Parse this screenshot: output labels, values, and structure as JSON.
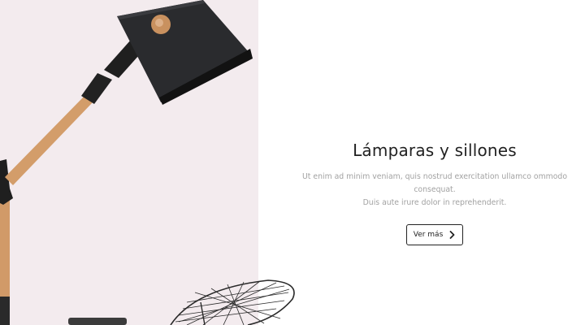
{
  "banner": {
    "title": "Lámparas y sillones",
    "description_line1": "Ut enim ad minim veniam, quis nostrud exercitation ullamco ommodo consequat.",
    "description_line2": "Duis aute irure dolor in reprehenderit.",
    "cta_label": "Ver más",
    "cta_icon": "chevron-right-icon"
  },
  "colors": {
    "left_panel_background": "#f3ebee",
    "title_text": "#222222",
    "description_text": "#a2a2a2",
    "button_border": "#222222"
  },
  "images": {
    "lamp": "desk-lamp-image",
    "chair": "wire-chair-image"
  }
}
